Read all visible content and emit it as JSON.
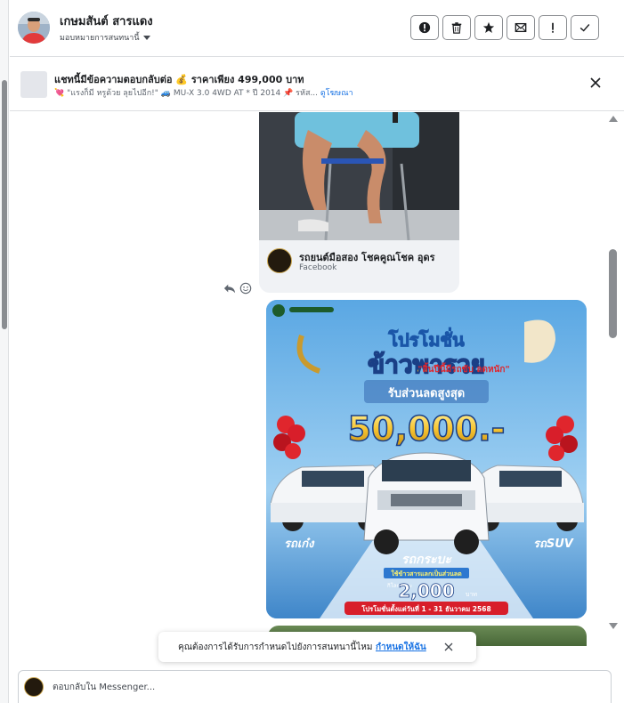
{
  "header": {
    "contact_name": "เกษมสันต์ สารแดง",
    "assign_label": "มอบหมายการสนทนานี้",
    "actions": [
      {
        "icon": "exclamation-circle-icon"
      },
      {
        "icon": "trash-icon"
      },
      {
        "icon": "star-icon"
      },
      {
        "icon": "mark-unread-icon"
      },
      {
        "icon": "exclamation-icon"
      },
      {
        "icon": "checkmark-icon"
      }
    ]
  },
  "ad_banner": {
    "title": "แชทนี้มีข้อความตอบกลับต่อ 💰 ราคาเพียง 499,000 บาท",
    "subtitle": "💘 \"แรงก็มี หรูด้วย ลุยไปอีก!\" 🚙 MU-X 3.0 4WD AT * ปี 2014 📌 รหัส...",
    "link": "ดูโฆษณา"
  },
  "shared_post": {
    "title": "รถยนต์มือสอง โชคคูณโชค อุดร",
    "source": "Facebook"
  },
  "promo_image": {
    "headline_1": "โปรโมชั่น",
    "headline_2": "ข้าวพารวย",
    "tagline": "\"สิ้นปีนี้มีรถขับ ลดหนัก\"",
    "discount_label": "รับส่วนลดสูงสุด",
    "discount_amount": "50,000.-",
    "left_label": "รถเก๋ง",
    "right_label": "รถSUV",
    "pickup_label": "รถกระบะ",
    "rice_note": "ใช้ข้าวสารแลกเป็นส่วนลด",
    "per_kg": "กิโลกรัมละ",
    "rice_amount": "2,000",
    "baht": "บาท",
    "period": "โปรโมชั่นตั้งแต่วันที่ 1 - 31 ธันวาคม 2568"
  },
  "toast": {
    "text": "คุณต้องการได้รับการกำหนดไปยังการสนทนานี้ไหม",
    "action": "กำหนดให้ฉัน"
  },
  "composer": {
    "placeholder": "ตอบกลับใน Messenger..."
  },
  "colors": {
    "link_blue": "#1b74e4",
    "bubble_gray": "#f0f2f5",
    "promo_red": "#d81e2a",
    "promo_gold": "#f7c531"
  }
}
